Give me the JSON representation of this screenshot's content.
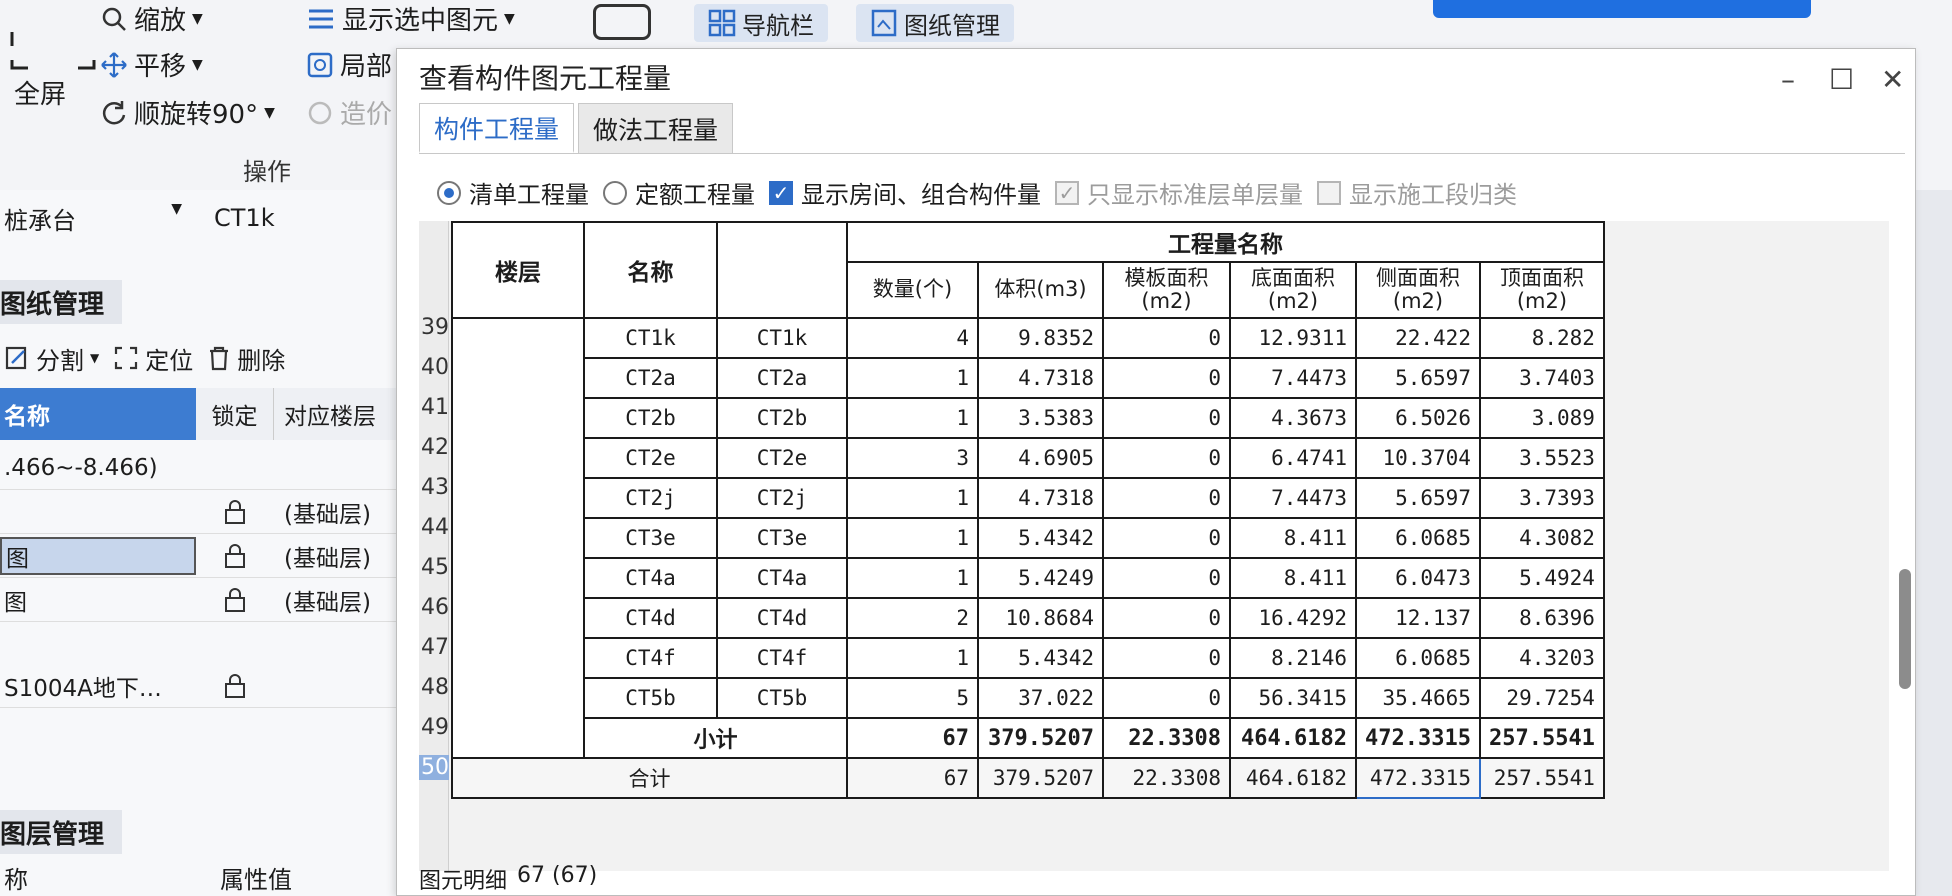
{
  "ribbon": {
    "fullscreen": "全屏",
    "zoom": "缩放",
    "pan": "平移",
    "rotate": "顺旋转90°",
    "show_selected": "显示选中图元",
    "local": "局部",
    "cost": "造价",
    "group_label": "操作",
    "nav_bar": "导航栏",
    "drawing_mgmt": "图纸管理"
  },
  "left_panel": {
    "component_type": "桩承台",
    "component_name": "CT1k",
    "tab_drawing": "图纸管理",
    "split": "分割",
    "locate": "定位",
    "delete": "删除",
    "col_name": "名称",
    "col_lock": "锁定",
    "col_floor": "对应楼层",
    "range": ".466~-8.466)",
    "rows": [
      {
        "name": "",
        "floor": "(基础层)"
      },
      {
        "name": "图",
        "floor": "(基础层)"
      },
      {
        "name": "图",
        "floor": "(基础层)"
      },
      {
        "name": "S1004A地下…",
        "floor": ""
      }
    ],
    "tab_layer": "图层管理",
    "prop_name": "称",
    "prop_value": "属性值"
  },
  "dialog": {
    "title": "查看构件图元工程量",
    "tabs": [
      "构件工程量",
      "做法工程量"
    ],
    "options": {
      "list_qty": "清单工程量",
      "quota_qty": "定额工程量",
      "show_room": "显示房间、组合构件量",
      "std_floor_only": "只显示标准层单层量",
      "show_stage": "显示施工段归类"
    },
    "table": {
      "h_floor": "楼层",
      "h_name": "名称",
      "h_group": "工程量名称",
      "cols": [
        "数量(个)",
        "体积(m3)",
        "模板面积(m2)",
        "底面面积(m2)",
        "侧面面积(m2)",
        "顶面面积(m2)"
      ],
      "rows": [
        {
          "n": "39",
          "name": "CT1k",
          "name2": "CT1k",
          "v": [
            "4",
            "9.8352",
            "0",
            "12.9311",
            "22.422",
            "8.282"
          ]
        },
        {
          "n": "40",
          "name": "CT2a",
          "name2": "CT2a",
          "v": [
            "1",
            "4.7318",
            "0",
            "7.4473",
            "5.6597",
            "3.7403"
          ]
        },
        {
          "n": "41",
          "name": "CT2b",
          "name2": "CT2b",
          "v": [
            "1",
            "3.5383",
            "0",
            "4.3673",
            "6.5026",
            "3.089"
          ]
        },
        {
          "n": "42",
          "name": "CT2e",
          "name2": "CT2e",
          "v": [
            "3",
            "4.6905",
            "0",
            "6.4741",
            "10.3704",
            "3.5523"
          ]
        },
        {
          "n": "43",
          "name": "CT2j",
          "name2": "CT2j",
          "v": [
            "1",
            "4.7318",
            "0",
            "7.4473",
            "5.6597",
            "3.7393"
          ]
        },
        {
          "n": "44",
          "name": "CT3e",
          "name2": "CT3e",
          "v": [
            "1",
            "5.4342",
            "0",
            "8.411",
            "6.0685",
            "4.3082"
          ]
        },
        {
          "n": "45",
          "name": "CT4a",
          "name2": "CT4a",
          "v": [
            "1",
            "5.4249",
            "0",
            "8.411",
            "6.0473",
            "5.4924"
          ]
        },
        {
          "n": "46",
          "name": "CT4d",
          "name2": "CT4d",
          "v": [
            "2",
            "10.8684",
            "0",
            "16.4292",
            "12.137",
            "8.6396"
          ]
        },
        {
          "n": "47",
          "name": "CT4f",
          "name2": "CT4f",
          "v": [
            "1",
            "5.4342",
            "0",
            "8.2146",
            "6.0685",
            "4.3203"
          ]
        },
        {
          "n": "48",
          "name": "CT5b",
          "name2": "CT5b",
          "v": [
            "5",
            "37.022",
            "0",
            "56.3415",
            "35.4665",
            "29.7254"
          ]
        }
      ],
      "subtotal": {
        "n": "49",
        "label": "小计",
        "v": [
          "67",
          "379.5207",
          "22.3308",
          "464.6182",
          "472.3315",
          "257.5541"
        ]
      },
      "total": {
        "n": "50",
        "label": "合计",
        "v": [
          "67",
          "379.5207",
          "22.3308",
          "464.6182",
          "472.3315",
          "257.5541"
        ]
      }
    },
    "status_label": "图元明细",
    "status_value": "67 (67)"
  },
  "colors": {
    "accent": "#2d6cc7",
    "selection": "#3d7cd1"
  }
}
